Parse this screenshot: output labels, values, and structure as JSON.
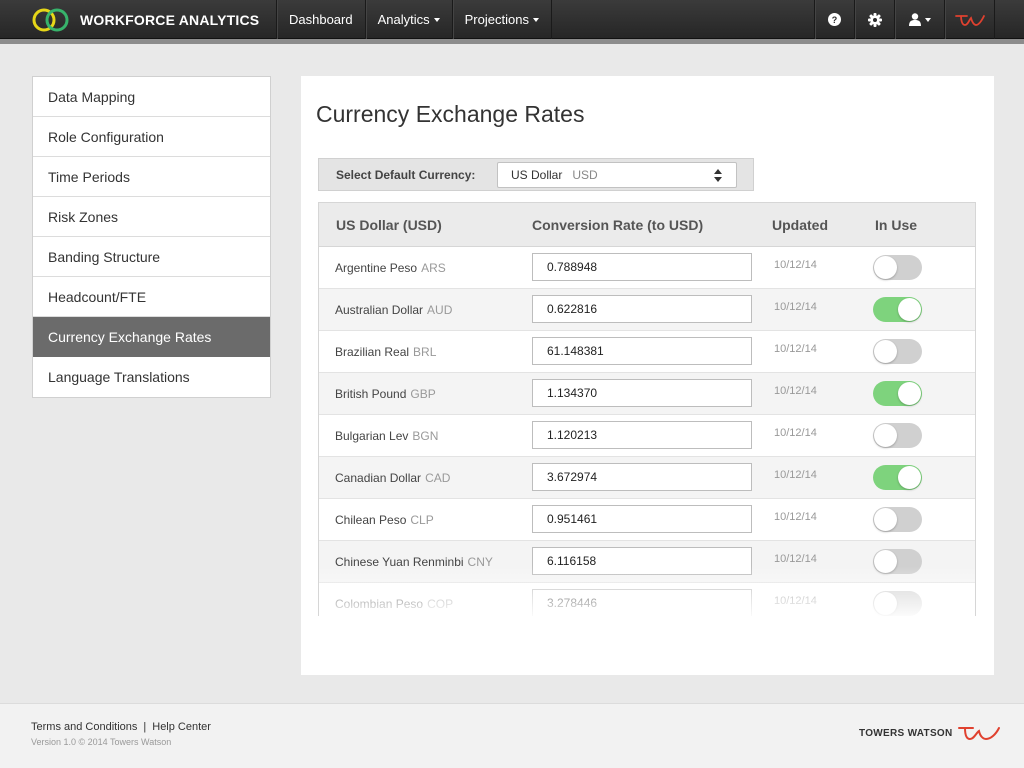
{
  "header": {
    "app_name": "WORKFORCE ANALYTICS",
    "nav": [
      {
        "label": "Dashboard",
        "has_caret": false
      },
      {
        "label": "Analytics",
        "has_caret": true
      },
      {
        "label": "Projections",
        "has_caret": true
      }
    ],
    "icons": [
      "help-icon",
      "gear-icon",
      "user-icon",
      "towers-watson-logo"
    ]
  },
  "sidebar": {
    "items": [
      {
        "label": "Data Mapping",
        "active": false
      },
      {
        "label": "Role Configuration",
        "active": false
      },
      {
        "label": "Time Periods",
        "active": false
      },
      {
        "label": "Risk Zones",
        "active": false
      },
      {
        "label": "Banding Structure",
        "active": false
      },
      {
        "label": "Headcount/FTE",
        "active": false
      },
      {
        "label": "Currency Exchange Rates",
        "active": true
      },
      {
        "label": "Language Translations",
        "active": false
      }
    ]
  },
  "main": {
    "title": "Currency Exchange Rates",
    "default_currency_label": "Select Default Currency:",
    "default_currency_name": "US Dollar",
    "default_currency_code": "USD",
    "table": {
      "columns": [
        "US Dollar (USD)",
        "Conversion Rate (to USD)",
        "Updated",
        "In Use"
      ],
      "rows": [
        {
          "name": "Argentine Peso",
          "code": "ARS",
          "rate": "0.788948",
          "updated": "10/12/14",
          "in_use": false
        },
        {
          "name": "Australian Dollar",
          "code": "AUD",
          "rate": "0.622816",
          "updated": "10/12/14",
          "in_use": true
        },
        {
          "name": "Brazilian Real",
          "code": "BRL",
          "rate": "61.148381",
          "updated": "10/12/14",
          "in_use": false
        },
        {
          "name": "British Pound",
          "code": "GBP",
          "rate": "1.134370",
          "updated": "10/12/14",
          "in_use": true
        },
        {
          "name": "Bulgarian Lev",
          "code": "BGN",
          "rate": "1.120213",
          "updated": "10/12/14",
          "in_use": false
        },
        {
          "name": "Canadian Dollar",
          "code": "CAD",
          "rate": "3.672974",
          "updated": "10/12/14",
          "in_use": true
        },
        {
          "name": "Chilean Peso",
          "code": "CLP",
          "rate": "0.951461",
          "updated": "10/12/14",
          "in_use": false
        },
        {
          "name": "Chinese Yuan Renminbi",
          "code": "CNY",
          "rate": "6.116158",
          "updated": "10/12/14",
          "in_use": false
        },
        {
          "name": "Colombian Peso",
          "code": "COP",
          "rate": "3.278446",
          "updated": "10/12/14",
          "in_use": false
        }
      ]
    }
  },
  "footer": {
    "terms": "Terms and Conditions",
    "separator": "|",
    "help": "Help Center",
    "version": "Version 1.0  © 2014 Towers Watson",
    "brand": "TOWERS WATSON"
  },
  "colors": {
    "toggle_on": "#7ed37d",
    "toggle_off": "#d0d0d0",
    "active_sidebar": "#6b6b6b",
    "brand_red": "#e0412f",
    "logo_yellow": "#e6d618",
    "logo_green": "#37b36b"
  }
}
